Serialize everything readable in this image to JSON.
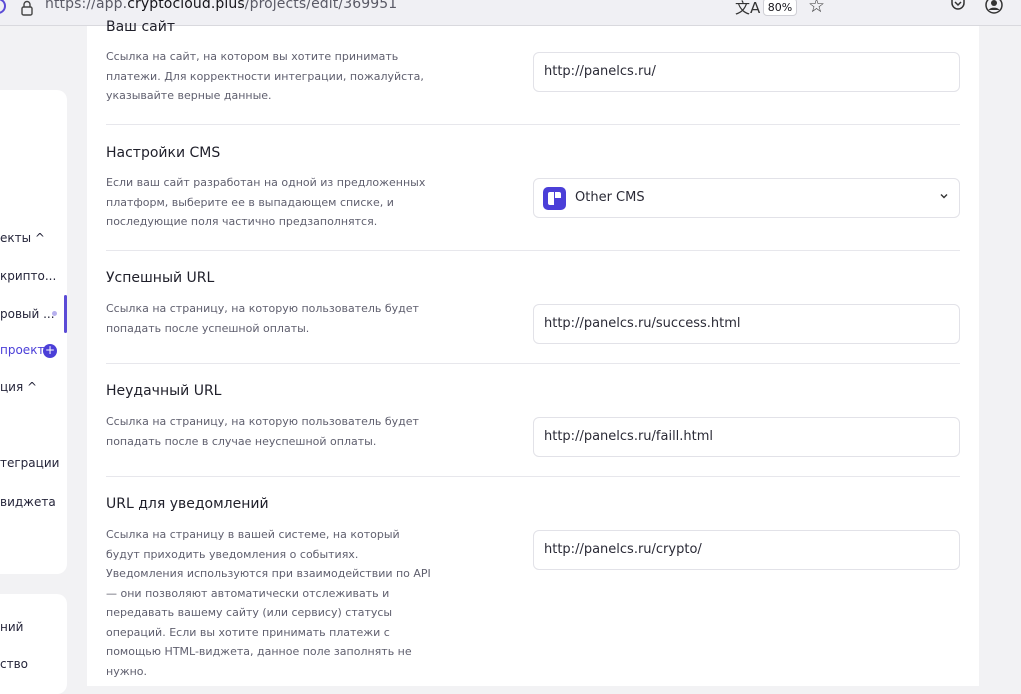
{
  "browser": {
    "url_prefix": "https://app.",
    "url_domain": "cryptocloud.plus",
    "url_path": "/projects/edit/369951",
    "zoom": "80%"
  },
  "sidebar": {
    "items": [
      {
        "label": "екты ^"
      },
      {
        "label": "крипто..."
      },
      {
        "label": "ровый ..."
      },
      {
        "label": "проект"
      },
      {
        "label": "ция ^"
      },
      {
        "label": "теграции"
      },
      {
        "label": "виджета"
      },
      {
        "label": "ний"
      },
      {
        "label": "ство"
      }
    ]
  },
  "sections": [
    {
      "title": "Ваш сайт",
      "description": "Ссылка на сайт, на котором вы хотите принимать платежи. Для корректности интеграции, пожалуйста, указывайте верные данные.",
      "value": "http://panelcs.ru/"
    },
    {
      "title": "Настройки CMS",
      "description": "Если ваш сайт разработан на одной из предложенных платформ, выберите ее в выпадающем списке, и последующие поля частично предзаполнятся.",
      "value": "Other CMS"
    },
    {
      "title": "Успешный URL",
      "description": "Ссылка на страницу, на которую пользователь будет попадать после успешной оплаты.",
      "value": "http://panelcs.ru/success.html"
    },
    {
      "title": "Неудачный URL",
      "description": "Ссылка на страницу, на которую пользователь будет попадать после в случае неуспешной оплаты.",
      "value": "http://panelcs.ru/faill.html"
    },
    {
      "title": "URL для уведомлений",
      "description": "Ссылка на страницу в вашей системе, на который будут приходить уведомления о событиях. Уведомления используются при взаимодействии по API — они позволяют автоматически отслеживать и передавать вашему сайту (или сервису) статусы операций. Если вы хотите принимать платежи с помощью HTML-виджета, данное поле заполнять не нужно.",
      "value": "http://panelcs.ru/crypto/"
    }
  ]
}
